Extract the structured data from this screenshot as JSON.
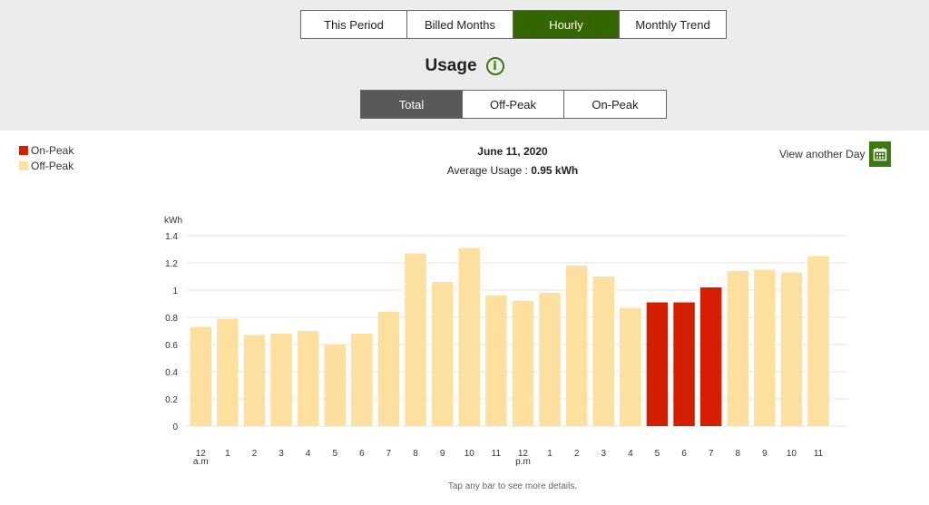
{
  "tabs": [
    {
      "label": "This Period",
      "active": false
    },
    {
      "label": "Billed Months",
      "active": false
    },
    {
      "label": "Hourly",
      "active": true
    },
    {
      "label": "Monthly Trend",
      "active": false
    }
  ],
  "title": "Usage",
  "info_icon": "info-icon",
  "subtabs": [
    {
      "label": "Total",
      "active": true
    },
    {
      "label": "Off-Peak",
      "active": false
    },
    {
      "label": "On-Peak",
      "active": false
    }
  ],
  "legend": [
    {
      "label": "On-Peak",
      "color": "#d41e00"
    },
    {
      "label": "Off-Peak",
      "color": "#fddf9f"
    }
  ],
  "date": "June 11, 2020",
  "average_label": "Average Usage : ",
  "average_value": "0.95 kWh",
  "view_another_day": "View another Day",
  "calendar_icon": "calendar-icon",
  "footer_hint": "Tap any bar to see more details.",
  "chart_data": {
    "type": "bar",
    "title": "",
    "xlabel": "",
    "ylabel": "kWh",
    "ylim": [
      0,
      1.4
    ],
    "yticks": [
      "0",
      "0.2",
      "0.4",
      "0.6",
      "0.8",
      "1",
      "1.2",
      "1.4"
    ],
    "ytick_values": [
      0,
      0.2,
      0.4,
      0.6,
      0.8,
      1,
      1.2,
      1.4
    ],
    "grid": true,
    "legend_position": "top-left",
    "categories": [
      "12",
      "1",
      "2",
      "3",
      "4",
      "5",
      "6",
      "7",
      "8",
      "9",
      "10",
      "11",
      "12",
      "1",
      "2",
      "3",
      "4",
      "5",
      "6",
      "7",
      "8",
      "9",
      "10",
      "11"
    ],
    "category_sublabels": {
      "0": "a.m",
      "12": "p.m"
    },
    "values": [
      0.73,
      0.79,
      0.67,
      0.68,
      0.7,
      0.6,
      0.68,
      0.84,
      1.27,
      1.06,
      1.31,
      0.96,
      0.92,
      0.98,
      1.18,
      1.1,
      0.87,
      0.91,
      0.91,
      1.02,
      1.14,
      1.15,
      1.13,
      1.25
    ],
    "peak": [
      "off",
      "off",
      "off",
      "off",
      "off",
      "off",
      "off",
      "off",
      "off",
      "off",
      "off",
      "off",
      "off",
      "off",
      "off",
      "off",
      "off",
      "on",
      "on",
      "on",
      "off",
      "off",
      "off",
      "off"
    ],
    "colors": {
      "on": "#d41e00",
      "off": "#fddf9f"
    }
  }
}
